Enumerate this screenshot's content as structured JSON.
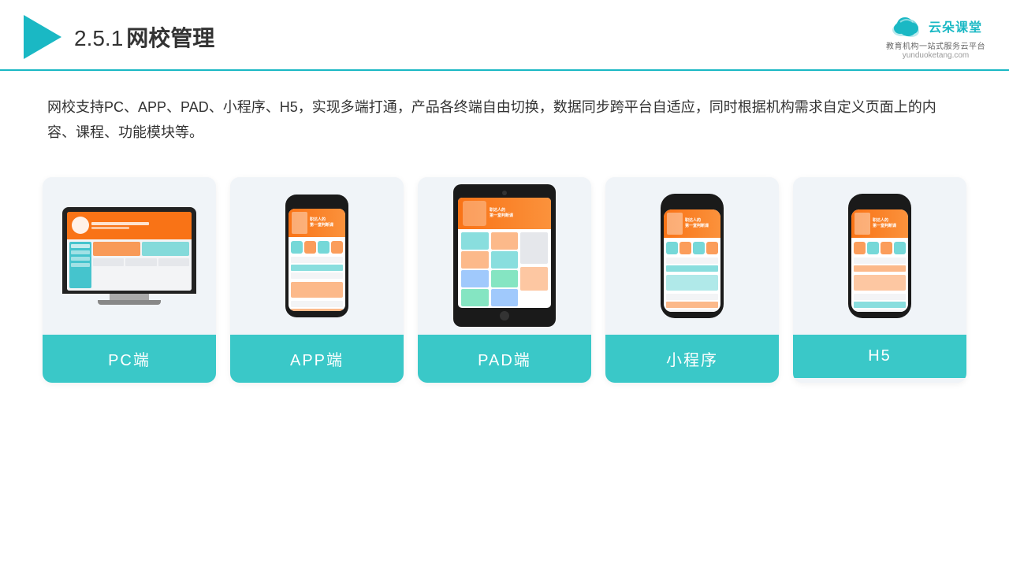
{
  "header": {
    "section": "2.5.1",
    "title": "网校管理",
    "logo_main": "云朵课堂",
    "logo_sub": "教育机构一站\n式服务云平台",
    "logo_domain": "yunduoketang.com"
  },
  "description": {
    "text": "网校支持PC、APP、PAD、小程序、H5，实现多端打通，产品各终端自由切换，数据同步跨平台自适应，同时根据机构需求自定义页面上的内容、课程、功能模块等。"
  },
  "cards": [
    {
      "id": "pc",
      "label": "PC端"
    },
    {
      "id": "app",
      "label": "APP端"
    },
    {
      "id": "pad",
      "label": "PAD端"
    },
    {
      "id": "miniapp",
      "label": "小程序"
    },
    {
      "id": "h5",
      "label": "H5"
    }
  ],
  "colors": {
    "teal": "#3ac8c8",
    "accent": "#1ab8c4",
    "orange": "#f97316"
  }
}
